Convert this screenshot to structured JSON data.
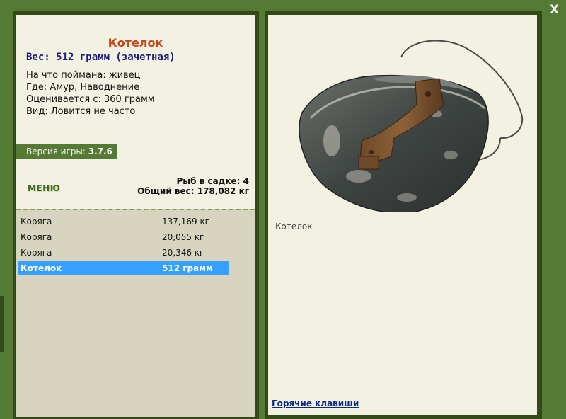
{
  "close_label": "X",
  "fish": {
    "title": "Котелок",
    "weight_line": "Вес: 512 грамм (зачетная)",
    "caught_on": "На что поймана: живец",
    "location": "Где: Амур, Наводнение",
    "rated_from": "Оценивается с: 360 грамм",
    "frequency": "Вид: Ловится не часто"
  },
  "version": {
    "label": "Версия игры:",
    "value": "3.7.6"
  },
  "menu_label": "МЕНЮ",
  "keepnet": {
    "count_line": "Рыб в садке: 4",
    "total_line": "Общий вес: 178,082 кг"
  },
  "catch_list": [
    {
      "name": "Коряга",
      "weight": "137,169 кг"
    },
    {
      "name": "Коряга",
      "weight": "20,055 кг"
    },
    {
      "name": "Коряга",
      "weight": "20,346 кг"
    },
    {
      "name": "Котелок",
      "weight": "512 грамм",
      "selected": true
    }
  ],
  "preview": {
    "image_icon": "mess-tin-image",
    "caption": "Котелок",
    "hotkeys_link": "Горячие клавиши"
  },
  "colors": {
    "frame": "#557a33",
    "panel": "#f3f1e1",
    "selection": "#38a0ff",
    "title": "#c6471a"
  }
}
